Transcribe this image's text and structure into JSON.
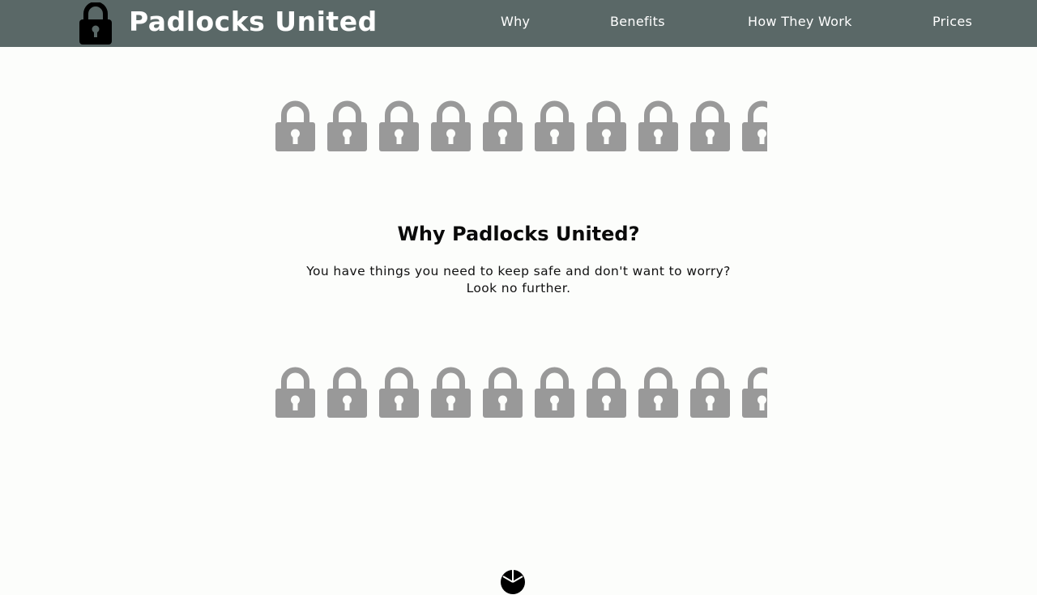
{
  "header": {
    "brand": "Padlocks United",
    "logo_icon": "padlock-icon",
    "background": "#5a6867",
    "nav": [
      {
        "label": "Why"
      },
      {
        "label": "Benefits"
      },
      {
        "label": "How They Work"
      },
      {
        "label": "Prices"
      }
    ]
  },
  "decor": {
    "icon": "padlock-icon",
    "color": "#999999"
  },
  "why": {
    "title": "Why Padlocks United?",
    "line1": "You have things you need to keep safe and don't want to worry?",
    "line2": "Look no further."
  },
  "footer": {
    "icon": "circle-icon"
  }
}
